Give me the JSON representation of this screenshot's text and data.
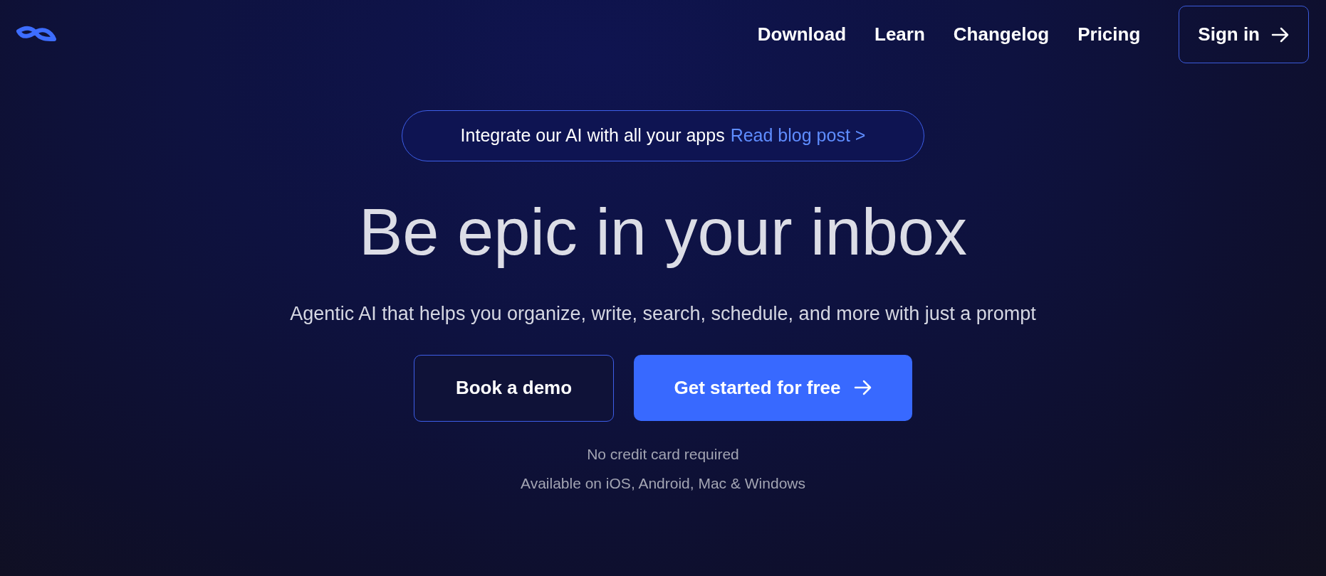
{
  "nav": {
    "links": [
      "Download",
      "Learn",
      "Changelog",
      "Pricing"
    ],
    "sign_in": "Sign in"
  },
  "announcement": {
    "text": "Integrate our AI with all your apps",
    "link": "Read blog post >"
  },
  "heading": "Be epic in your inbox",
  "subtitle": "Agentic AI that helps you organize, write, search, schedule, and more with just a prompt",
  "buttons": [
    {
      "label": "Book a demo",
      "kind": "secondary"
    },
    {
      "label": "Get started for free",
      "kind": "primary"
    }
  ],
  "notes": [
    "No credit card required",
    "Available on iOS, Android, Mac & Windows"
  ]
}
